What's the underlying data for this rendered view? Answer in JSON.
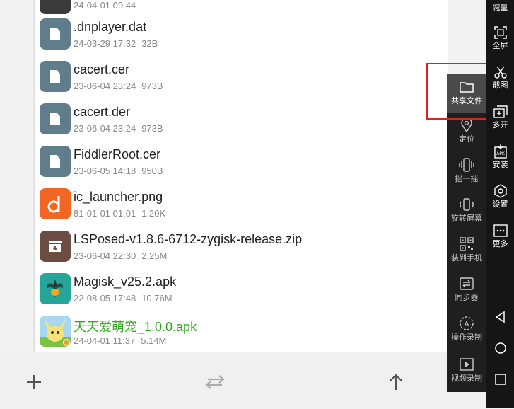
{
  "files": [
    {
      "name": "",
      "date": "24-04-01 09:44",
      "size": "",
      "icon": "dark-icon",
      "partial": true
    },
    {
      "name": ".dnplayer.dat",
      "date": "24-03-29 17:32",
      "size": "32B",
      "icon": "file-icon"
    },
    {
      "name": "cacert.cer",
      "date": "23-06-04 23:24",
      "size": "973B",
      "icon": "file-icon"
    },
    {
      "name": "cacert.der",
      "date": "23-06-04 23:24",
      "size": "973B",
      "icon": "file-icon"
    },
    {
      "name": "FiddlerRoot.cer",
      "date": "23-06-05 14:18",
      "size": "950B",
      "icon": "file-icon"
    },
    {
      "name": "ic_launcher.png",
      "date": "81-01-01 01:01",
      "size": "1.20K",
      "icon": "png-launcher-icon"
    },
    {
      "name": "LSPosed-v1.8.6-6712-zygisk-release.zip",
      "date": "23-06-04 22:30",
      "size": "2.25M",
      "icon": "zip-archive-icon"
    },
    {
      "name": "Magisk_v25.2.apk",
      "date": "22-08-05 17:48",
      "size": "10.76M",
      "icon": "magisk-app-icon"
    },
    {
      "name": "天天爱萌宠_1.0.0.apk",
      "date": "24-04-01 11:37",
      "size": "5.14M",
      "icon": "pet-game-apk-icon",
      "highlight_color": "#2eaa1c"
    }
  ],
  "bottom_bar": {
    "add": "plus-icon",
    "transfer": "swap-arrows-icon",
    "up": "arrow-up-icon"
  },
  "tool_panel": [
    {
      "label": "共享文件",
      "icon": "folder-icon",
      "active": true
    },
    {
      "label": "定位",
      "icon": "location-pin-icon"
    },
    {
      "label": "摇一摇",
      "icon": "shake-phone-icon"
    },
    {
      "label": "旋转屏幕",
      "icon": "rotate-screen-icon"
    },
    {
      "label": "装到手机",
      "icon": "qr-code-icon"
    },
    {
      "label": "同步器",
      "icon": "sync-icon"
    },
    {
      "label": "操作录制",
      "icon": "macro-record-icon"
    },
    {
      "label": "视频录制",
      "icon": "video-record-icon"
    }
  ],
  "right_strip": [
    {
      "label": "减量",
      "icon": ""
    },
    {
      "label": "全屏",
      "icon": "fullscreen-icon"
    },
    {
      "label": "截图",
      "icon": "scissors-icon"
    },
    {
      "label": "多开",
      "icon": "multi-instance-icon"
    },
    {
      "label": "安装",
      "icon": "apk-install-icon"
    },
    {
      "label": "设置",
      "icon": "settings-icon"
    },
    {
      "label": "更多",
      "icon": "more-icon"
    }
  ],
  "nav_buttons": [
    "back-triangle-icon",
    "home-circle-icon",
    "recents-square-icon"
  ],
  "colors": {
    "highlight_box": "#e01f1f",
    "apk_name": "#2eaa1c"
  }
}
